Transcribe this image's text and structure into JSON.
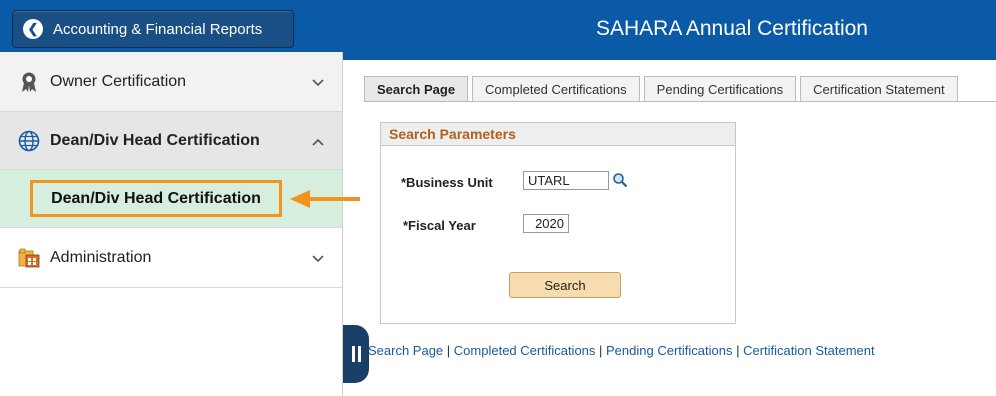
{
  "header": {
    "back_label": "Accounting & Financial Reports",
    "title": "SAHARA Annual Certification"
  },
  "sidebar": {
    "items": [
      {
        "label": "Owner Certification",
        "icon": "award-ribbon-icon"
      },
      {
        "label": "Dean/Div Head Certification",
        "icon": "globe-icon"
      },
      {
        "label": "Dean/Div Head Certification"
      },
      {
        "label": "Administration",
        "icon": "admin-folder-icon"
      }
    ]
  },
  "tabs": [
    {
      "label": "Search Page",
      "active": true
    },
    {
      "label": "Completed Certifications"
    },
    {
      "label": "Pending Certifications"
    },
    {
      "label": "Certification Statement"
    }
  ],
  "search": {
    "heading": "Search Parameters",
    "business_unit_label": "*Business Unit",
    "business_unit_value": "UTARL",
    "fiscal_year_label": "*Fiscal Year",
    "fiscal_year_value": "2020",
    "search_button": "Search"
  },
  "footer_links": {
    "search_page": "Search Page",
    "completed": "Completed Certifications",
    "pending": "Pending Certifications",
    "statement": "Certification Statement",
    "separator": " | "
  },
  "colors": {
    "header_blue": "#0a5aa8",
    "highlight_orange": "#f0941d",
    "selected_green": "#d6eedd",
    "section_heading": "#b0601a"
  }
}
